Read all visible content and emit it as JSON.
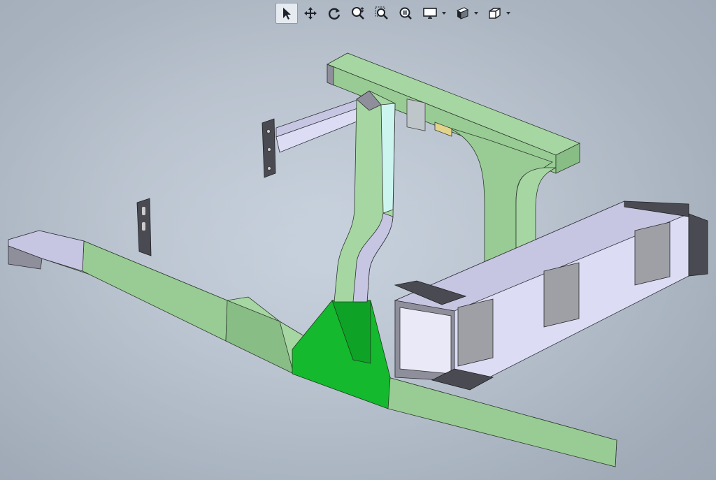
{
  "app": {
    "type": "cad-3d-viewport"
  },
  "toolbar": {
    "items": [
      {
        "name": "select-icon",
        "active": true,
        "dropdown": false
      },
      {
        "name": "pan-icon",
        "active": false,
        "dropdown": false
      },
      {
        "name": "rotate-icon",
        "active": false,
        "dropdown": false
      },
      {
        "name": "zoom-in-out-icon",
        "active": false,
        "dropdown": false
      },
      {
        "name": "zoom-to-area-icon",
        "active": false,
        "dropdown": false
      },
      {
        "name": "zoom-to-fit-icon",
        "active": false,
        "dropdown": false
      },
      {
        "name": "display-style-icon",
        "active": false,
        "dropdown": true
      },
      {
        "name": "section-view-icon",
        "active": false,
        "dropdown": true
      },
      {
        "name": "view-orientation-icon",
        "active": false,
        "dropdown": true
      }
    ]
  },
  "model": {
    "name": "welded-frame-assembly",
    "colors": {
      "tube_face_light": "#a6d6a2",
      "tube_face_mid": "#98cc94",
      "tube_face_dark": "#88bd86",
      "selected_face": "#14b92e",
      "selected_face_dark": "#0ea326",
      "steel_light": "#dcdcf4",
      "steel_mid": "#c6c6e2",
      "steel_dark": "#8e8f9b",
      "bracket_dark": "#4a4b52",
      "plate": "#9ea0a6",
      "accent_tab": "#e3d48c"
    }
  }
}
